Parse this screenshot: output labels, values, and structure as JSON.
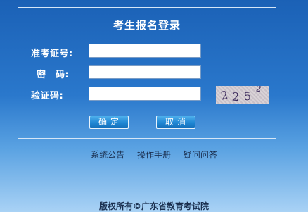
{
  "login": {
    "title": "考生报名登录",
    "id_label": "准考证号:",
    "password_label": "密　码:",
    "captcha_label": "验证码:",
    "id_value": "",
    "password_value": "",
    "captcha_value": "",
    "captcha_chars": [
      "2",
      "2",
      "5",
      "2"
    ],
    "submit_label": "确定",
    "cancel_label": "取消"
  },
  "links": {
    "announcement": "系统公告",
    "manual": "操作手册",
    "faq": "疑问问答"
  },
  "footer": {
    "copyright": "版权所有©广东省教育考试院"
  },
  "colors": {
    "background_top": "#1b61b6",
    "background_bottom": "#a9d2f5",
    "button": "#1f86d3"
  }
}
